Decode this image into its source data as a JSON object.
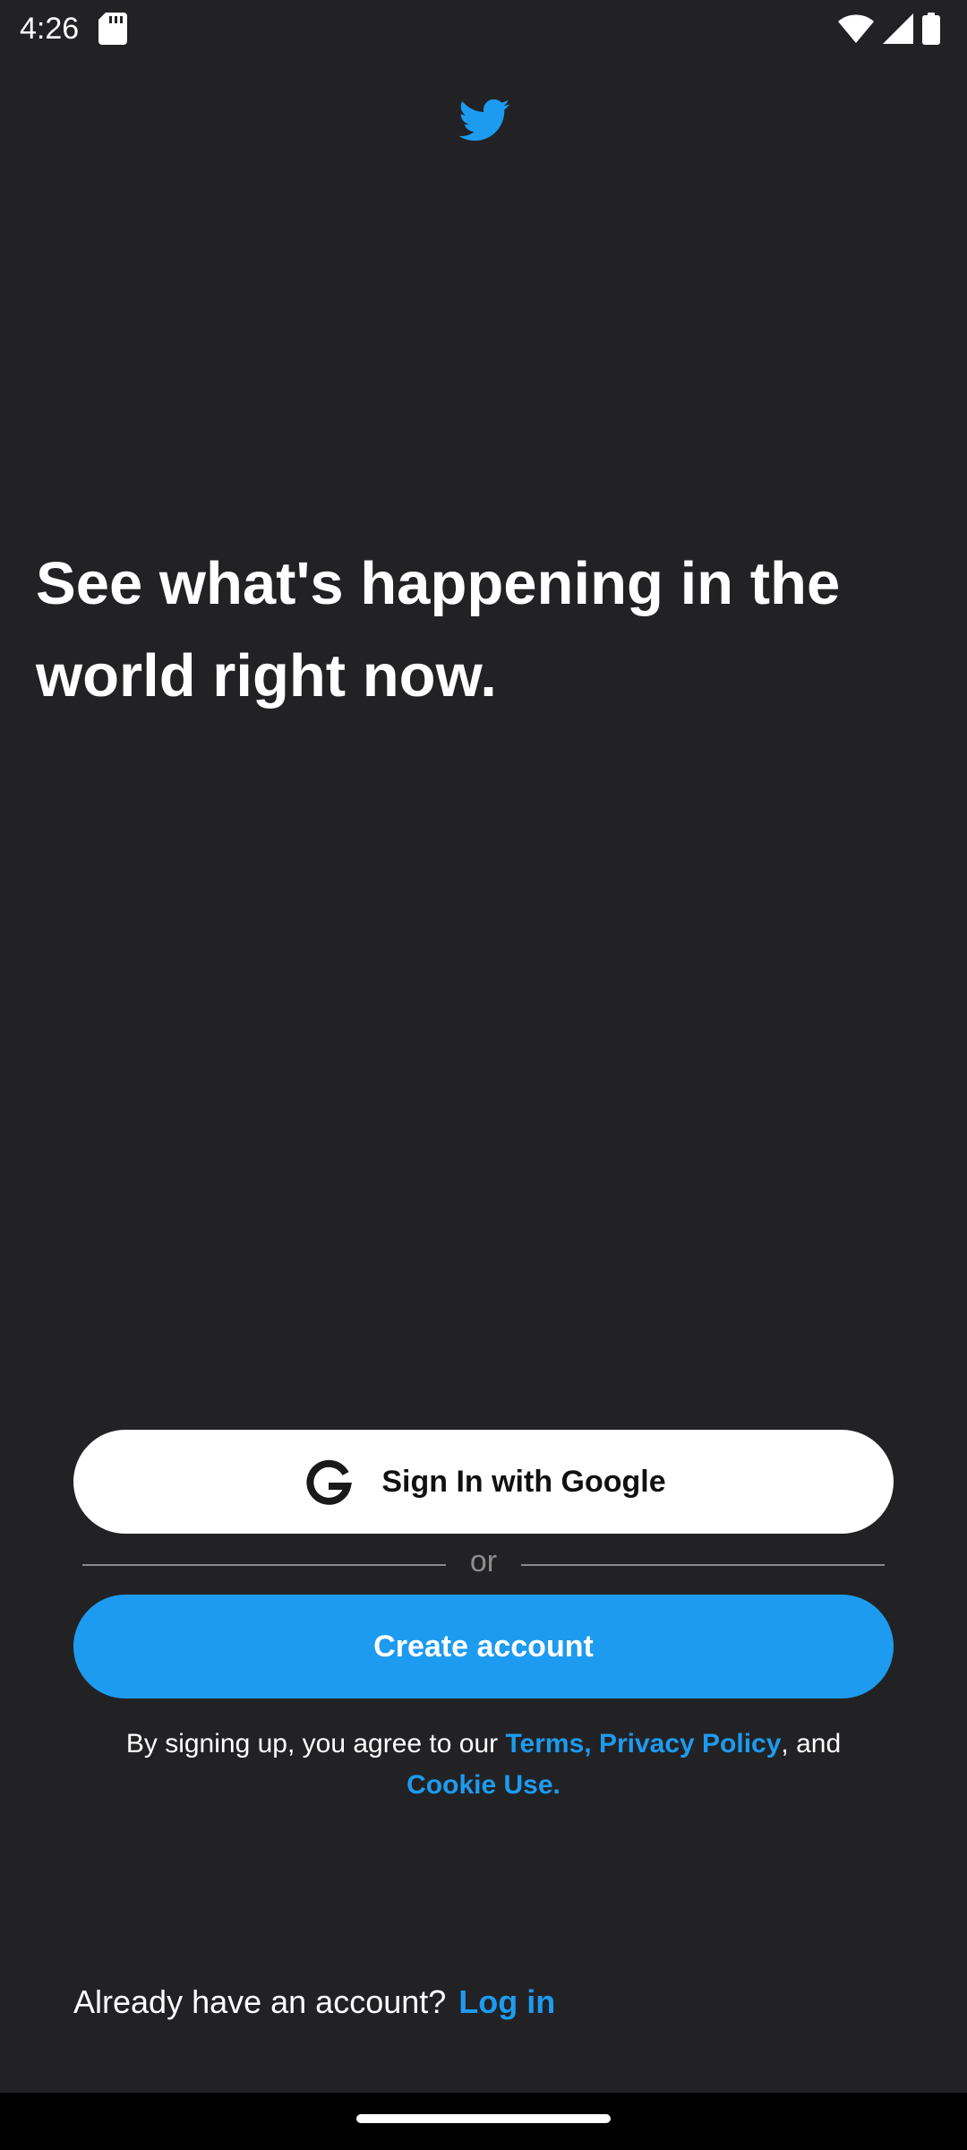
{
  "status_bar": {
    "time": "4:26",
    "icons": [
      "sd-card-icon",
      "wifi-icon",
      "signal-icon",
      "battery-icon"
    ]
  },
  "brand": {
    "logo_icon": "twitter-bird-icon",
    "accent_color": "#1d9bf0",
    "background_color": "#222224"
  },
  "main": {
    "headline": "See what's happening in the world right now."
  },
  "auth": {
    "google_button_label": "Sign In with Google",
    "google_icon": "google-g-icon",
    "divider_text": "or",
    "create_account_label": "Create account"
  },
  "legal": {
    "prefix": "By signing up, you agree to our ",
    "terms_label": "Terms,",
    "space": " ",
    "privacy_label": "Privacy Policy",
    "and_text": ", and",
    "cookie_label": "Cookie Use."
  },
  "login": {
    "prompt": "Already have an account?",
    "link_label": "Log in"
  }
}
